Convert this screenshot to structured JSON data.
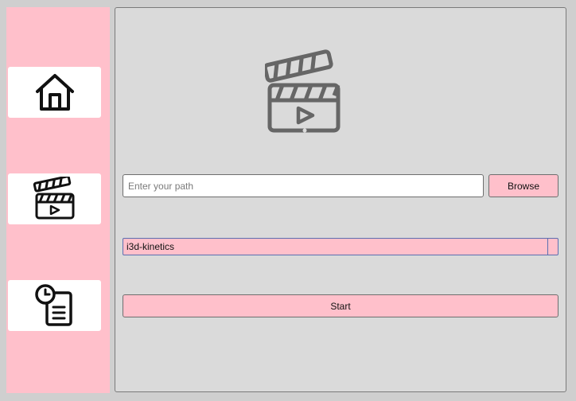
{
  "sidebar": {
    "items": [
      {
        "icon": "home-icon"
      },
      {
        "icon": "clapperboard-icon"
      },
      {
        "icon": "history-document-icon"
      }
    ]
  },
  "main": {
    "hero_icon": "clapperboard-icon",
    "path_input": {
      "value": "",
      "placeholder": "Enter your path"
    },
    "browse_label": "Browse",
    "model_select": {
      "selected": "i3d-kinetics"
    },
    "start_label": "Start"
  },
  "colors": {
    "accent": "#ffc0cb",
    "panel": "#dadada",
    "icon_dark": "#111111",
    "icon_gray": "#666666"
  }
}
